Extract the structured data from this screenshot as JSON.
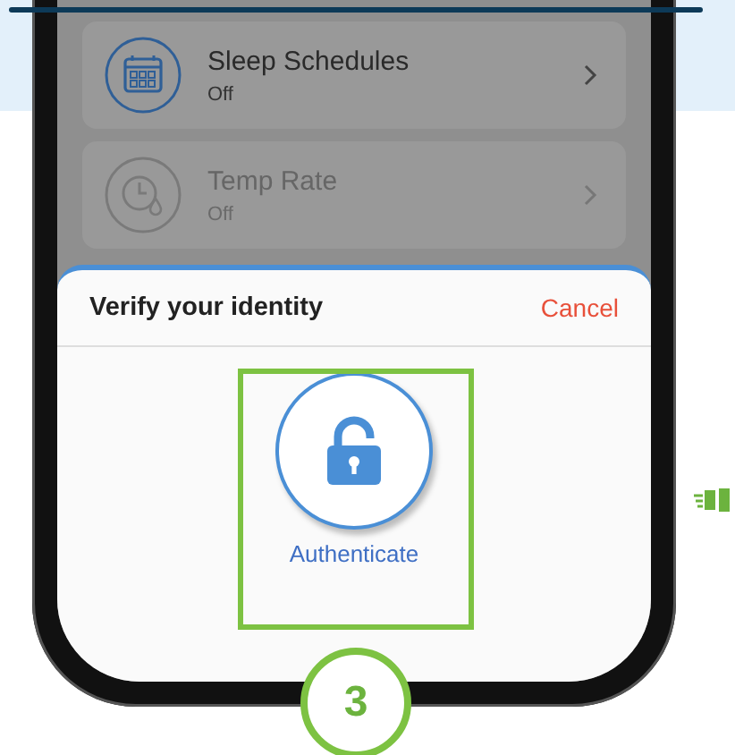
{
  "settings": [
    {
      "title": "Sleep Schedules",
      "status": "Off",
      "active": true
    },
    {
      "title": "Temp Rate",
      "status": "Off",
      "active": false
    }
  ],
  "sheet": {
    "title": "Verify your identity",
    "cancel": "Cancel",
    "action": "Authenticate"
  },
  "step_badge": "3"
}
